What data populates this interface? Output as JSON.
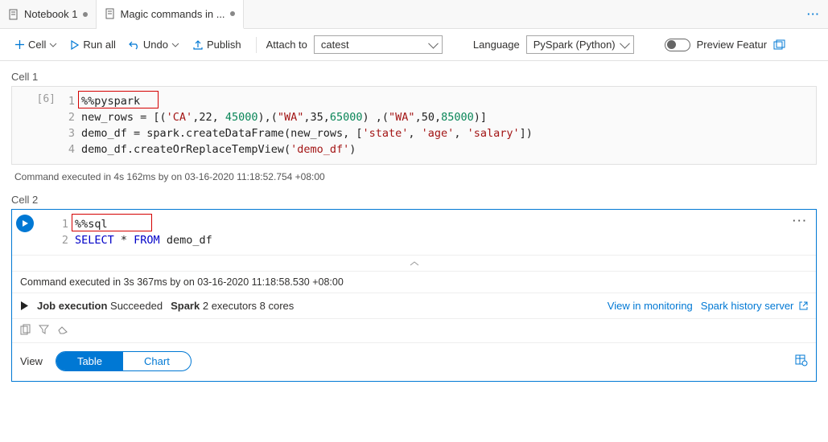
{
  "tabs": {
    "tab1": "Notebook 1",
    "tab2": "Magic commands in ..."
  },
  "toolbar": {
    "cell": "Cell",
    "runall": "Run all",
    "undo": "Undo",
    "publish": "Publish",
    "attach_label": "Attach to",
    "attach_value": "catest",
    "language_label": "Language",
    "language_value": "PySpark (Python)",
    "preview": "Preview Featur"
  },
  "cell1": {
    "label": "Cell 1",
    "exec_index": "[6]",
    "lines": {
      "l1": "%%pyspark",
      "l2a": "new_rows = [(",
      "l2b": "'CA'",
      "l2c": ",22, ",
      "l2d": "45000",
      "l2e": "),(",
      "l2f": "\"WA\"",
      "l2g": ",35,",
      "l2h": "65000",
      "l2i": ") ,(",
      "l2j": "\"WA\"",
      "l2k": ",50,",
      "l2l": "85000",
      "l2m": ")]",
      "l3a": "demo_df = spark.createDataFrame(new_rows, [",
      "l3b": "'state'",
      "l3c": ", ",
      "l3d": "'age'",
      "l3e": ", ",
      "l3f": "'salary'",
      "l3g": "])",
      "l4a": "demo_df.createOrReplaceTempView(",
      "l4b": "'demo_df'",
      "l4c": ")"
    },
    "status": "Command executed in 4s 162ms by       on 03-16-2020 11:18:52.754 +08:00"
  },
  "cell2": {
    "label": "Cell 2",
    "lines": {
      "l1": "%%sql",
      "l2a": "SELECT",
      "l2b": " * ",
      "l2c": "FROM",
      "l2d": " demo_df"
    },
    "status": "Command executed in 3s 367ms by       on 03-16-2020 11:18:58.530 +08:00",
    "job_label": "Job execution",
    "job_status": " Succeeded",
    "spark_label": "Spark",
    "spark_detail": " 2 executors 8 cores",
    "view_monitoring": "View in monitoring",
    "history_server": "Spark history server",
    "view_label": "View",
    "tab_table": "Table",
    "tab_chart": "Chart"
  }
}
